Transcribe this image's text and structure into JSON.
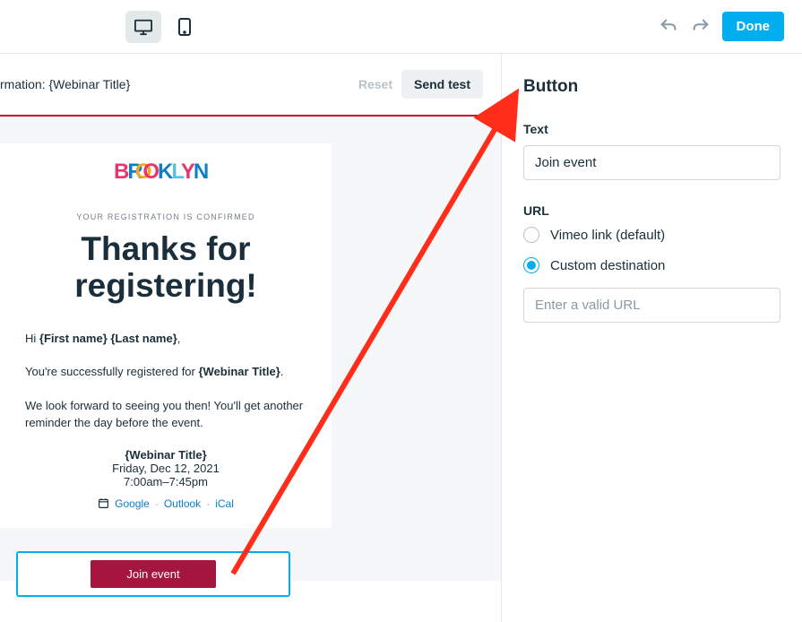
{
  "topbar": {
    "done_label": "Done"
  },
  "preview": {
    "title": "rmation: {Webinar Title}",
    "reset_label": "Reset",
    "send_test_label": "Send test"
  },
  "email": {
    "confirm_label": "YOUR REGISTRATION IS CONFIRMED",
    "headline": "Thanks for registering!",
    "greeting_prefix": "Hi ",
    "greeting_name": "{First name} {Last name}",
    "greeting_suffix": ",",
    "line2_prefix": "You're successfully registered for ",
    "line2_title": "{Webinar Title}",
    "line2_suffix": ".",
    "line3": "We look forward to seeing you then! You'll get another reminder the day before the event.",
    "event_title": "{Webinar Title}",
    "event_date": "Friday, Dec 12, 2021",
    "event_time": "7:00am–7:45pm",
    "cal_google": "Google",
    "cal_outlook": "Outlook",
    "cal_ical": "iCal",
    "join_button": "Join event"
  },
  "panel": {
    "title": "Button",
    "text_field_label": "Text",
    "text_field_value": "Join event",
    "url_label": "URL",
    "radio_default": "Vimeo link (default)",
    "radio_custom": "Custom destination",
    "url_placeholder": "Enter a valid URL"
  }
}
